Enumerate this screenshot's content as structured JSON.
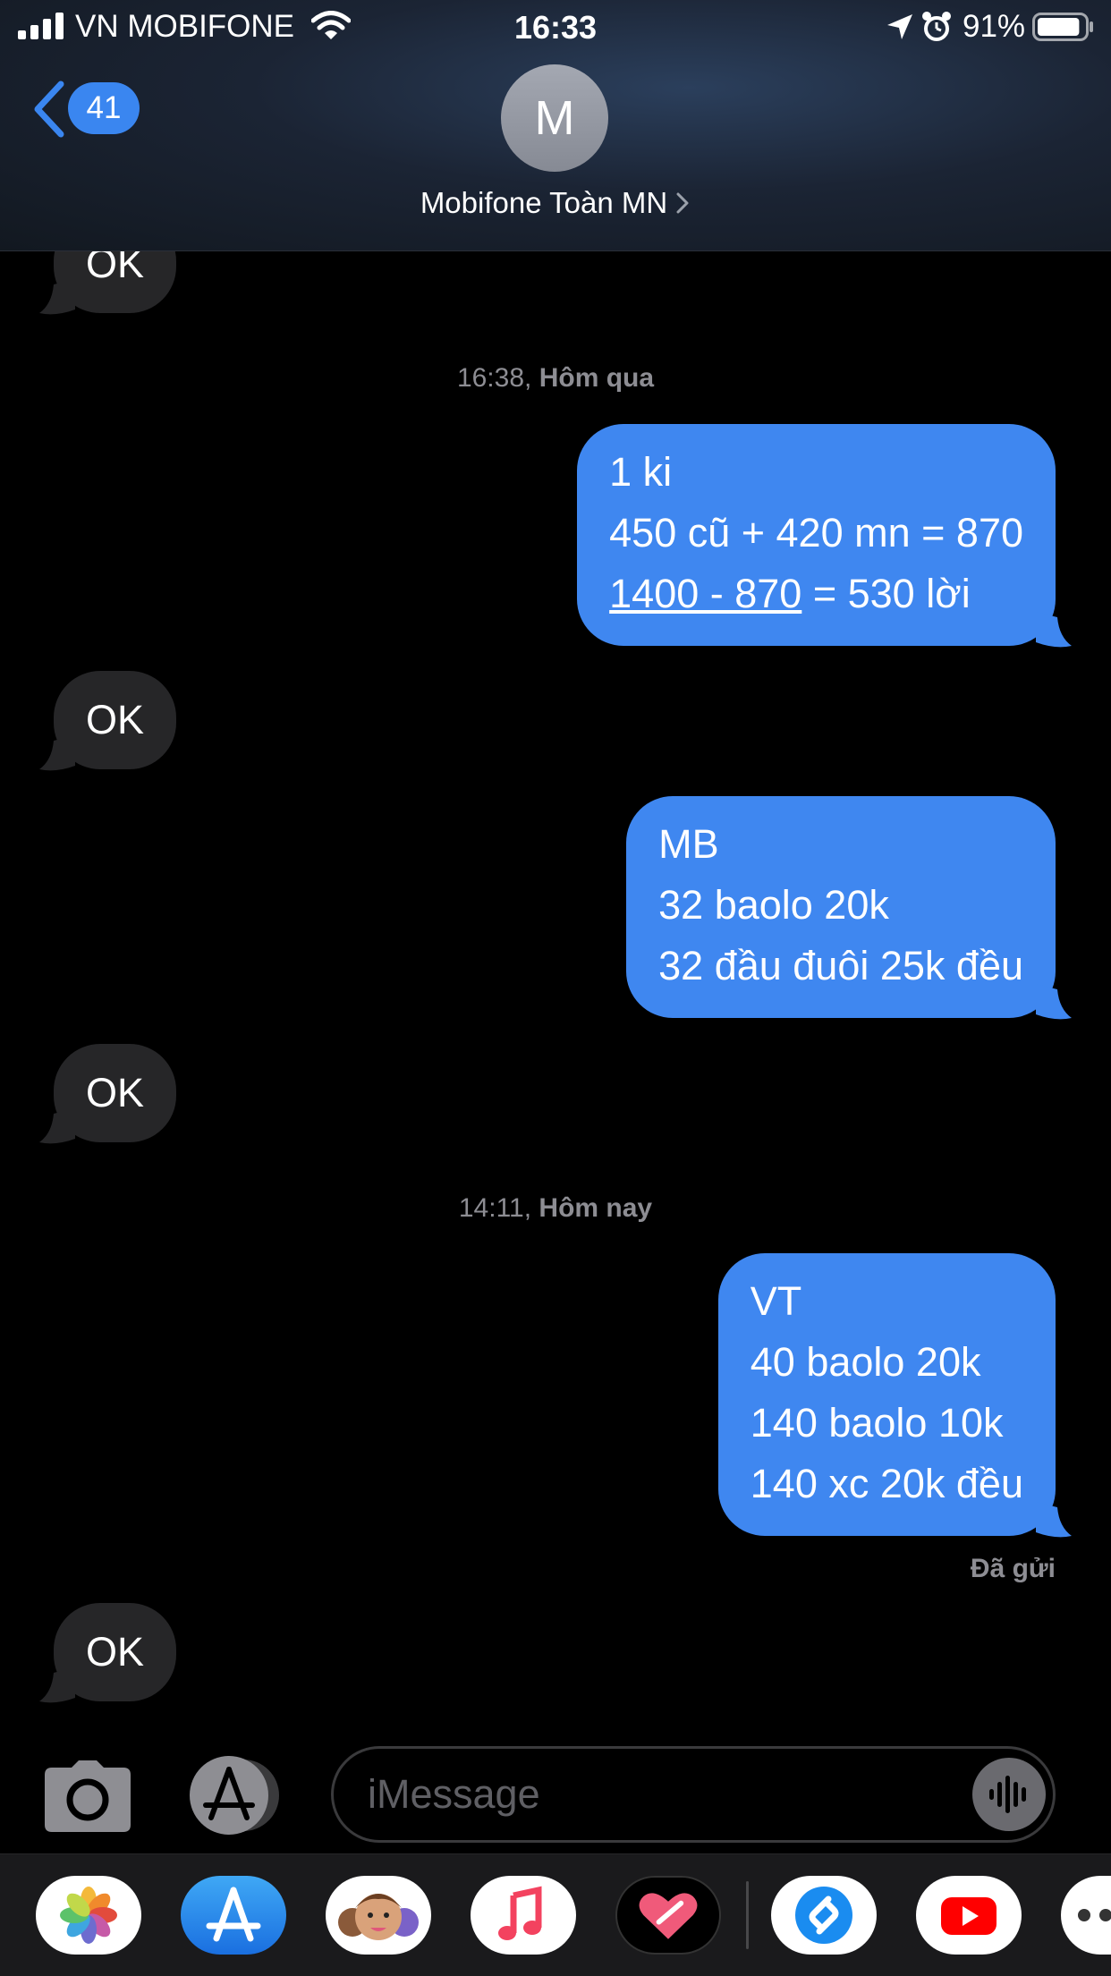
{
  "status_bar": {
    "carrier": "VN MOBIFONE",
    "time": "16:33",
    "battery_percent": "91%",
    "battery_level": 0.91,
    "icons": [
      "signal-icon",
      "wifi-icon",
      "location-icon",
      "alarm-icon",
      "battery-icon"
    ]
  },
  "header": {
    "back_badge": "41",
    "avatar_initial": "M",
    "contact_name": "Mobifone Toàn MN"
  },
  "conversation": {
    "timestamps": [
      {
        "time": "16:38,",
        "day": "Hôm qua"
      },
      {
        "time": "14:11,",
        "day": "Hôm nay"
      }
    ],
    "messages": [
      {
        "direction": "incoming",
        "lines": [
          "OK"
        ]
      },
      {
        "direction": "outgoing",
        "lines": [
          "1 ki",
          "450 cũ + 420 mn = 870",
          "1400 - 870",
          " = 530 lời"
        ]
      },
      {
        "direction": "incoming",
        "lines": [
          "OK"
        ]
      },
      {
        "direction": "outgoing",
        "lines": [
          "MB",
          "32 baolo 20k",
          "32 đầu đuôi 25k đều"
        ]
      },
      {
        "direction": "incoming",
        "lines": [
          "OK"
        ]
      },
      {
        "direction": "outgoing",
        "lines": [
          "VT",
          "40 baolo 20k",
          "140 baolo 10k",
          "140 xc 20k đều"
        ]
      },
      {
        "direction": "incoming",
        "lines": [
          "OK"
        ]
      }
    ],
    "delivery_status": "Đã gửi"
  },
  "input": {
    "placeholder": "iMessage",
    "icons": [
      "camera-icon",
      "app-store-icon",
      "audio-waveform-icon"
    ]
  },
  "app_drawer": {
    "apps": [
      "photos-icon",
      "app-store-icon",
      "memoji-icon",
      "music-icon",
      "digital-touch-icon",
      "shazam-icon",
      "youtube-icon",
      "more-icon"
    ]
  },
  "colors": {
    "outgoing_bubble": "#3f87f0",
    "incoming_bubble": "#262628",
    "accent": "#3a86f0",
    "meta_text": "#8d8d93"
  }
}
